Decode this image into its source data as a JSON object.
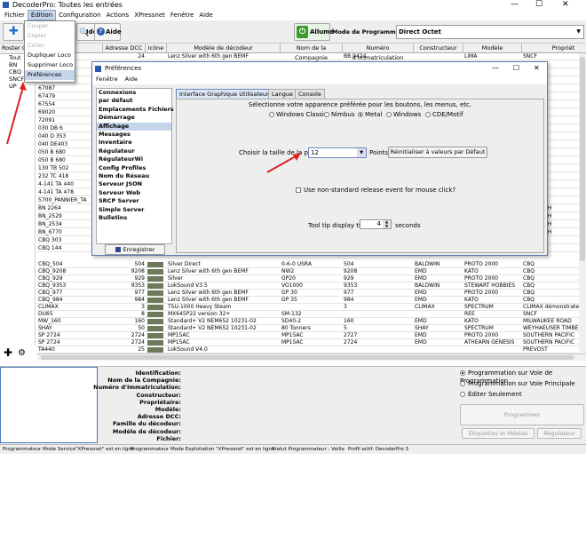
{
  "window": {
    "title": "DecoderPro: Toutes les entrées"
  },
  "menu": [
    "Fichier",
    "Édition",
    "Configuration",
    "Actions",
    "XPressnet",
    "Fenêtre",
    "Aide"
  ],
  "toolbar": {
    "identify": "Identifier",
    "help": "Aide",
    "power": "Allumé",
    "prog_mode_label": "Mode de Programmation",
    "prog_mode_value": "Direct Octet"
  },
  "edit_menu": {
    "items": [
      {
        "label": "Couper",
        "enabled": false
      },
      {
        "label": "Copier",
        "enabled": false
      },
      {
        "label": "Coller",
        "enabled": false
      },
      {
        "label": "Dupliquer Loco",
        "enabled": true
      },
      {
        "label": "Supprimer Loco",
        "enabled": true
      },
      {
        "label": "Préférences",
        "enabled": true
      }
    ]
  },
  "roster_groups": {
    "header": "Roster G",
    "items": [
      "Tout",
      "BN",
      "CBQ",
      "SNCF",
      "UP"
    ]
  },
  "table": {
    "columns": [
      "ID",
      "Adresse DCC",
      "Icône",
      "Modèle de décodeur",
      "Nom de la Compagnie",
      "Numéro d'Immatriculation",
      "Constructeur",
      "Modèle",
      "Propriét"
    ],
    "rows_top": [
      [
        "",
        "24",
        "",
        "Lenz Silver with 6th gen BEMF",
        "",
        "BB 9424",
        "",
        "LIMA",
        "SNCF"
      ],
      [
        "65089",
        "",
        "",
        "",
        "",
        "",
        "",
        "",
        ""
      ],
      [
        "66105",
        "",
        "",
        "",
        "",
        "",
        "",
        "",
        ""
      ],
      [
        "66472",
        "",
        "",
        "",
        "",
        "",
        "",
        "",
        ""
      ],
      [
        "67087",
        "",
        "",
        "",
        "",
        "",
        "",
        "",
        ""
      ],
      [
        "67479",
        "",
        "",
        "",
        "",
        "",
        "",
        "",
        ""
      ],
      [
        "67554",
        "",
        "",
        "",
        "",
        "",
        "",
        "",
        ""
      ],
      [
        "69020",
        "",
        "",
        "",
        "",
        "",
        "",
        "",
        ""
      ],
      [
        "72091",
        "",
        "",
        "",
        "",
        "",
        "",
        "",
        ""
      ],
      [
        "030 DB 6",
        "",
        "",
        "",
        "",
        "",
        "",
        "",
        ""
      ],
      [
        "040 D 353",
        "",
        "",
        "",
        "",
        "",
        "",
        "",
        ""
      ],
      [
        "040 DE403",
        "",
        "",
        "",
        "",
        "",
        "",
        "",
        ""
      ],
      [
        "050 B 680",
        "",
        "",
        "",
        "",
        "",
        "",
        "",
        ""
      ],
      [
        "050 B 680",
        "",
        "",
        "",
        "",
        "",
        "",
        "",
        ""
      ],
      [
        "130 TB 502",
        "",
        "",
        "",
        "",
        "",
        "",
        "",
        ""
      ],
      [
        "232 TC 418",
        "",
        "",
        "",
        "",
        "",
        "",
        "",
        ""
      ],
      [
        "4-141 TA 440",
        "",
        "",
        "",
        "",
        "",
        "",
        "",
        ""
      ],
      [
        "4-141 TA 478",
        "",
        "",
        "",
        "",
        "",
        "",
        "",
        ""
      ],
      [
        "5700_PANNIER_TA",
        "",
        "",
        "",
        "",
        "",
        "",
        "",
        "NIL"
      ],
      [
        "BN 2264",
        "",
        "",
        "",
        "",
        "",
        "",
        "",
        "ON NORTH"
      ],
      [
        "BN_2529",
        "",
        "",
        "",
        "",
        "",
        "",
        "",
        "ON NORTH"
      ],
      [
        "BN_2534",
        "",
        "",
        "",
        "",
        "",
        "",
        "",
        "ON NORTH"
      ],
      [
        "BN_6770",
        "",
        "",
        "",
        "",
        "",
        "",
        "",
        "ON NORTH"
      ],
      [
        "CBQ 303",
        "",
        "",
        "",
        "",
        "",
        "",
        "",
        ""
      ],
      [
        "CBQ 144",
        "",
        "",
        "",
        "",
        "",
        "",
        "",
        ""
      ]
    ],
    "rows_bottom": [
      [
        "CBQ_504",
        "504",
        "",
        "Silver Direct",
        "0-6-0 USRA",
        "504",
        "BALDWIN",
        "PROTO 2000",
        "CBQ"
      ],
      [
        "CBQ_9208",
        "9208",
        "",
        "Lenz Silver with 6th gen BEMF",
        "NW2",
        "9208",
        "EMD",
        "KATO",
        "CBQ"
      ],
      [
        "CBQ_929",
        "929",
        "",
        "Silver",
        "GP20",
        "929",
        "EMD",
        "PROTO 2000",
        "CBQ"
      ],
      [
        "CBQ_9353",
        "9353",
        "",
        "LokSound V3.5",
        "VO1000",
        "9353",
        "BALDWIN",
        "STEWART HOBBIES",
        "CBQ"
      ],
      [
        "CBQ_977",
        "977",
        "",
        "Lenz Silver with 6th gen BEMF",
        "GP 30",
        "977",
        "EMD",
        "PROTO 2000",
        "CBQ"
      ],
      [
        "CBQ_984",
        "984",
        "",
        "Lenz Silver with 6th gen BEMF",
        "GP 35",
        "984",
        "EMD",
        "KATO",
        "CBQ"
      ],
      [
        "CLIMAX",
        "3",
        "",
        "TSU-1000 Heavy Steam",
        "",
        "3",
        "CLIMAX",
        "SPECTRUM",
        "CLIMAX démonstrateur"
      ],
      [
        "DU65",
        "8",
        "",
        "MX645P22 version 32+",
        "SM-132",
        "",
        "",
        "REE",
        "SNCF"
      ],
      [
        "MW_160",
        "160",
        "",
        "Standard+ V2 NEM652 10231-02",
        "SD40-2",
        "160",
        "EMD",
        "KATO",
        "MILWAUKEE ROAD"
      ],
      [
        "SHAY",
        "50",
        "",
        "Standard+ V2 NEM652 10231-02",
        "80 Tonners",
        "5",
        "SHAY",
        "SPECTRUM",
        "WEYHAEUSER TIMBE"
      ],
      [
        "SP 2724",
        "2724",
        "",
        "MP15AC",
        "MP15AC",
        "2727",
        "EMD",
        "PROTO 2000",
        "SOUTHERN PACIFIC"
      ],
      [
        "SP 2724",
        "2724",
        "",
        "MP15AC",
        "MP15AC",
        "2724",
        "EMD",
        "ATHEARN GENESIS",
        "SOUTHERN PACIFIC"
      ],
      [
        "TA440",
        "25",
        "",
        "LokSound V4.0",
        "",
        "",
        "",
        "",
        "PREVOST"
      ]
    ]
  },
  "details": {
    "labels": [
      "Identification:",
      "Nom de la Compagnie:",
      "Numéro d'Immatriculation:",
      "Constructeur:",
      "Propriétaire:",
      "Modèle:",
      "Adresse DCC:",
      "Famille du décodeur:",
      "Modèle de décodeur:",
      "Fichier:"
    ],
    "radios": [
      {
        "label": "Programmation sur Voie de Programmation",
        "selected": true
      },
      {
        "label": "Programmation sur Voie Principale",
        "selected": false
      },
      {
        "label": "Éditer Seulement",
        "selected": false
      }
    ],
    "program_btn": "Programmer",
    "labels_btn": "Étiquettes et Médias",
    "throttle_btn": "Régulateur"
  },
  "status": {
    "service": "Programmateur Mode Service\"XPressnet\" est en ligne",
    "ops": "Programmateur Mode Exploitation \"XPressnet\" est en ligne",
    "state": "Statut Programmateur : Veille",
    "profile": "Profil actif: DecoderPro 3"
  },
  "prefs": {
    "title": "Préférences",
    "menu": [
      "Fenêtre",
      "Aide"
    ],
    "categories": [
      "Connexions",
      "par défaut",
      "Emplacements Fichiers",
      "Démarrage",
      "Affichage",
      "Messages",
      "Inventaire",
      "Régulateur",
      "RégulateurWi",
      "Config Profiles",
      "Nom du Réseau",
      "Serveur JSON",
      "Serveur Web",
      "SRCP Server",
      "Simple Server",
      "Bulletins"
    ],
    "selected": "Affichage",
    "tabs": [
      "Interface Graphique Utilisateur",
      "Langue",
      "Console"
    ],
    "active_tab": "Interface Graphique Utilisateur",
    "laf_prompt": "Sélectionne votre apparence préférée pour les boutons, les menus, etc.",
    "laf_options": [
      {
        "label": "Windows Classic",
        "selected": false
      },
      {
        "label": "Nimbus",
        "selected": false
      },
      {
        "label": "Metal",
        "selected": true
      },
      {
        "label": "Windows",
        "selected": false
      },
      {
        "label": "CDE/Motif",
        "selected": false
      }
    ],
    "font_label": "Choisir la taille de la police",
    "font_value": "12",
    "font_unit": "Points",
    "reset_btn": "Réinitialiser à valeurs par Défaut",
    "nonstd_label": "Use non-standard release event for mouse click?",
    "tooltip_label": "Tool tip display time",
    "tooltip_value": "4",
    "tooltip_unit": "seconds",
    "save_btn": "Enregistrer"
  },
  "colors": {
    "accent": "#4a7ab8",
    "annotation": "#e02020",
    "power_green": "#3a9a2a"
  }
}
